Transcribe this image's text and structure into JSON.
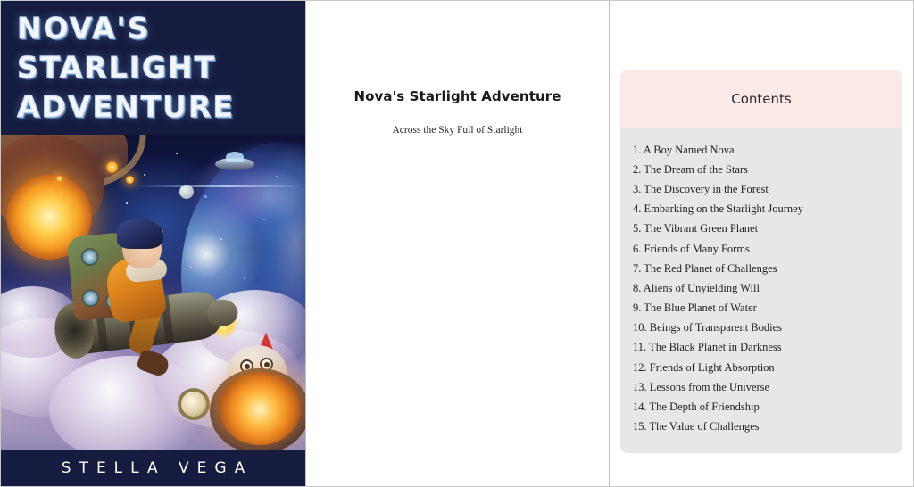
{
  "cover": {
    "title_lines": [
      "NOVA'S",
      "STARLIGHT",
      "ADVENTURE"
    ],
    "author": "STELLA VEGA",
    "background_color": "#161b40",
    "title_color": "#f3f6fb"
  },
  "title_page": {
    "title": "Nova's Starlight Adventure",
    "subtitle": "Across the Sky Full of Starlight"
  },
  "contents": {
    "header": "Contents",
    "header_background": "#fbe9e7",
    "list_background": "#e7e7e7",
    "items": [
      "1. A Boy Named Nova",
      "2. The Dream of the Stars",
      "3. The Discovery in the Forest",
      "4. Embarking on the Starlight Journey",
      "5. The Vibrant Green Planet",
      "6. Friends of Many Forms",
      "7. The Red Planet of Challenges",
      "8. Aliens of Unyielding Will",
      "9. The Blue Planet of Water",
      "10. Beings of Transparent Bodies",
      "11. The Black Planet in Darkness",
      "12. Friends of Light Absorption",
      "13. Lessons from the Universe",
      "14. The Depth of Friendship",
      "15. The Value of Challenges"
    ]
  }
}
